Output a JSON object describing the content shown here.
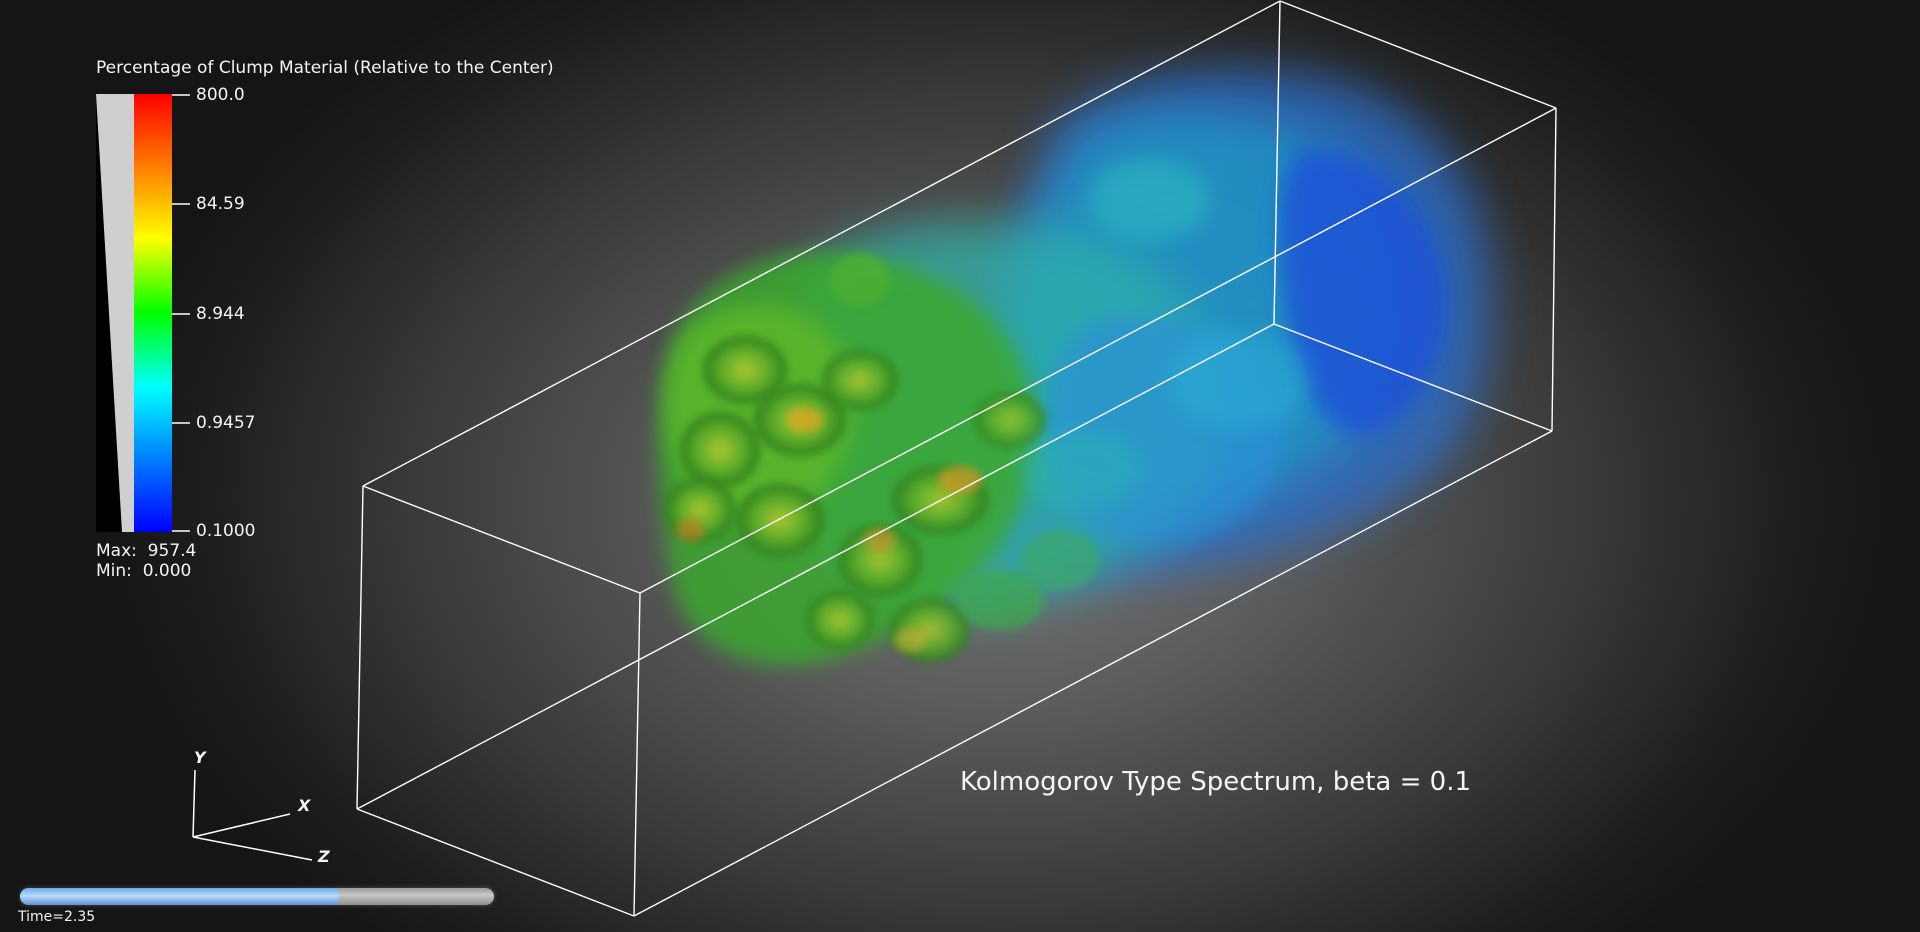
{
  "colorbar": {
    "title": "Percentage of Clump Material (Relative to the Center)",
    "ticks": [
      "800.0",
      "84.59",
      "8.944",
      "0.9457",
      "0.1000"
    ],
    "max_label": "Max:  957.4",
    "min_label": "Min:  0.000",
    "colormap": [
      "#ff0000",
      "#ff8000",
      "#ffff00",
      "#00ff00",
      "#00ffff",
      "#0080ff",
      "#0000ff"
    ]
  },
  "title": "Kolmogorov Type Spectrum, beta = 0.1",
  "axes": {
    "y": "Y",
    "x": "X",
    "z": "Z"
  },
  "time": {
    "label": "Time=2.35",
    "progress": 0.67
  },
  "colors": {
    "background": "#5a5a5a",
    "box": "#ffffff",
    "progress": "#8fc4ff"
  }
}
